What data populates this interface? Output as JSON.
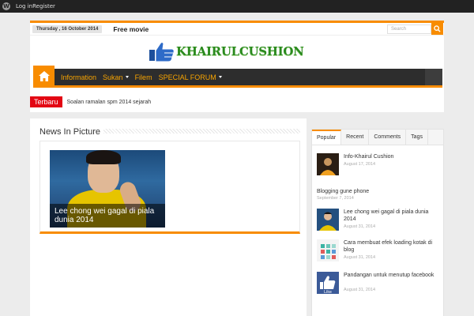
{
  "adminbar": {
    "login": "Log in",
    "register": "Register"
  },
  "topbar": {
    "date": "Thursday , 16 October 2014",
    "menu": "Free movie",
    "search_placeholder": "Search"
  },
  "logo": {
    "text": "KHAIRULCUSHION"
  },
  "nav": {
    "items": [
      "Information",
      "Sukan",
      "Filem",
      "SPECIAL FORUM"
    ]
  },
  "ticker": {
    "label": "Terbaru",
    "text": "Soalan ramalan spm 2014 sejarah"
  },
  "main": {
    "title": "News In Picture",
    "caption": "Lee chong wei gagal di piala dunia 2014"
  },
  "sidebar": {
    "tabs": [
      "Popular",
      "Recent",
      "Comments",
      "Tags"
    ],
    "posts": [
      {
        "title": "Info-Khairul Cushion",
        "date": "August 17, 2014"
      },
      {
        "title": "Blogging gune phone",
        "date": "September 7, 2014"
      },
      {
        "title": "Lee chong wei gagal di piala dunia 2014",
        "date": "August 31, 2014"
      },
      {
        "title": "Cara membuat efek loading kotak di blog",
        "date": "August 31, 2014"
      },
      {
        "title": "Pandangan untuk menutup facebook",
        "date": "August 31, 2014"
      }
    ]
  },
  "colors": {
    "accent": "#f88c00",
    "nav_bg": "#2d2d2d",
    "ticker": "#e30613",
    "logo": "#2a8a1e"
  }
}
